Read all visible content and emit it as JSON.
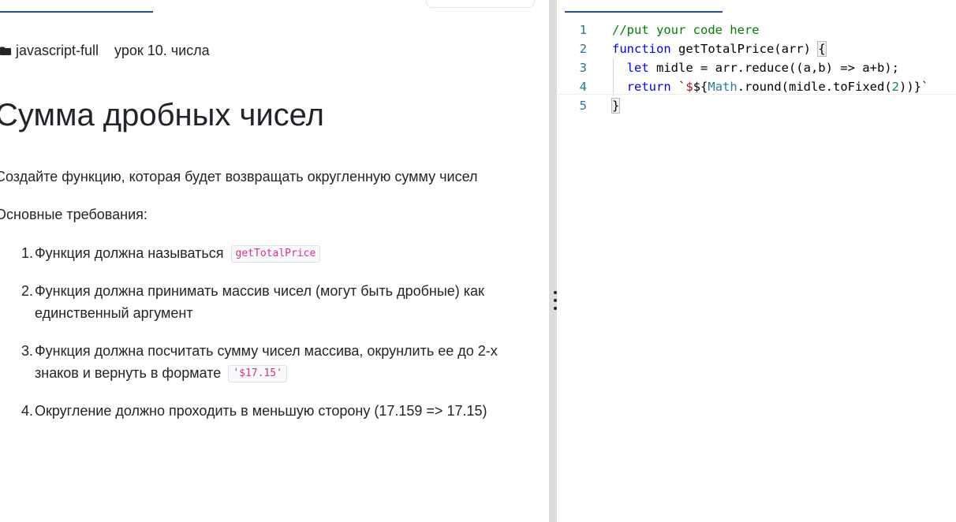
{
  "breadcrumb": {
    "course": "javascript-full",
    "lesson": "урок 10. числа"
  },
  "task": {
    "title": "Сумма дробных чисел",
    "description": "Создайте функцию, которая будет возвращать округленную сумму чисел",
    "requirements_heading": "Основные требования:",
    "requirements": [
      {
        "num": "1.",
        "text": "Функция должна называться",
        "code": "getTotalPrice"
      },
      {
        "num": "2.",
        "text": "Функция должна принимать массив чисел (могут быть дробные) как единственный аргумент",
        "code": ""
      },
      {
        "num": "3.",
        "text": "Функция должна посчитать сумму чисел массива, окрунлить ее до 2-х знаков и вернуть в формате",
        "code": "'$17.15'"
      },
      {
        "num": "4.",
        "text": "Округление должно проходить в меньшую сторону (17.159 => 17.15)",
        "code": ""
      }
    ]
  },
  "editor": {
    "lines": [
      {
        "num": "1",
        "tokens": [
          {
            "t": "//put your code here",
            "k": "comment"
          }
        ]
      },
      {
        "num": "2",
        "tokens": [
          {
            "t": "function",
            "k": "keyword"
          },
          {
            "t": " getTotalPrice(arr) ",
            "k": "plain"
          },
          {
            "t": "{",
            "k": "brace"
          }
        ]
      },
      {
        "num": "3",
        "tokens": [
          {
            "t": "  ",
            "k": "plain"
          },
          {
            "t": "let",
            "k": "keyword"
          },
          {
            "t": " midle = arr.reduce((a,b) => a+b);",
            "k": "plain"
          }
        ]
      },
      {
        "num": "4",
        "tokens": [
          {
            "t": "  ",
            "k": "plain"
          },
          {
            "t": "return",
            "k": "keyword"
          },
          {
            "t": " `",
            "k": "plain"
          },
          {
            "t": "$",
            "k": "string"
          },
          {
            "t": "${",
            "k": "plain"
          },
          {
            "t": "Math",
            "k": "type"
          },
          {
            "t": ".round(midle.toFixed(",
            "k": "plain"
          },
          {
            "t": "2",
            "k": "number"
          },
          {
            "t": "))}`",
            "k": "plain"
          }
        ]
      },
      {
        "num": "5",
        "tokens": [
          {
            "t": "}",
            "k": "brace-cursor"
          }
        ]
      }
    ]
  },
  "colors": {
    "accent": "#2a4d82",
    "code_chip": "#d63384",
    "comment": "#008000",
    "keyword": "#0000ff",
    "line_number": "#237893"
  },
  "icons": {
    "breadcrumb": "folder-icon",
    "splitter": "drag-handle-icon"
  }
}
